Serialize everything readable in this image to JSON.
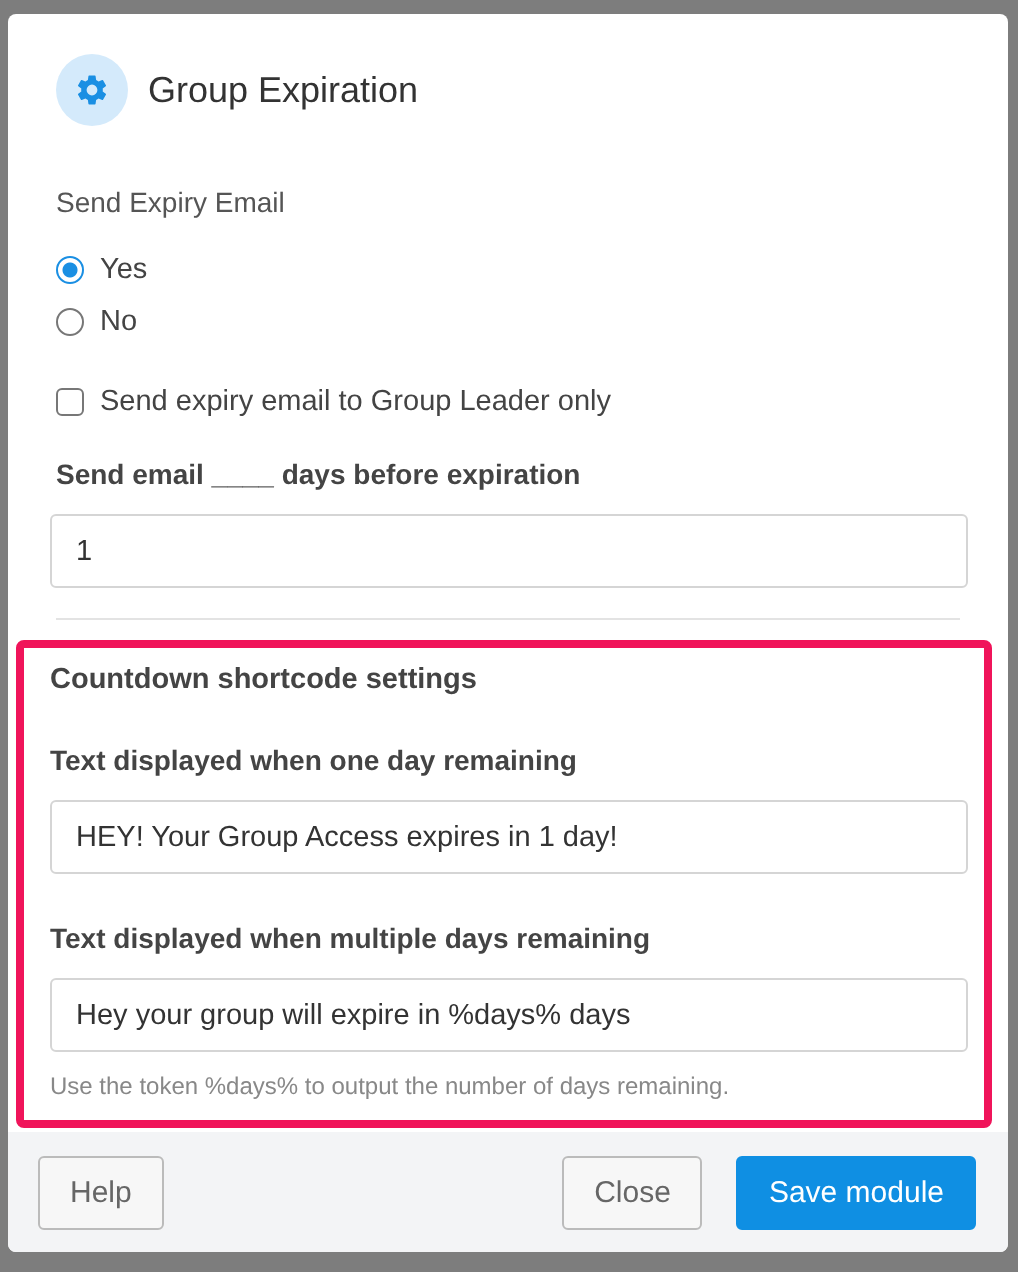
{
  "modal": {
    "title": "Group Expiration",
    "expiry_email": {
      "label": "Send Expiry Email",
      "options": [
        {
          "label": "Yes",
          "selected": true
        },
        {
          "label": "No",
          "selected": false
        }
      ]
    },
    "leader_only": {
      "label": "Send expiry email to Group Leader only",
      "checked": false
    },
    "days_before": {
      "label": "Send email ____ days before expiration",
      "value": "1"
    },
    "countdown": {
      "highlighted": true,
      "heading": "Countdown shortcode settings",
      "fields": [
        {
          "label": "Text displayed when one day remaining",
          "value": "HEY! Your Group Access expires in 1 day!"
        },
        {
          "label": "Text displayed when multiple days remaining",
          "value": "Hey your group will expire in %days% days"
        }
      ],
      "hint": "Use the token %days% to output the number of days remaining."
    },
    "buttons": [
      {
        "label": "Help",
        "kind": "secondary"
      },
      {
        "label": "Close",
        "kind": "secondary"
      },
      {
        "label": "Save module",
        "kind": "primary"
      }
    ]
  }
}
